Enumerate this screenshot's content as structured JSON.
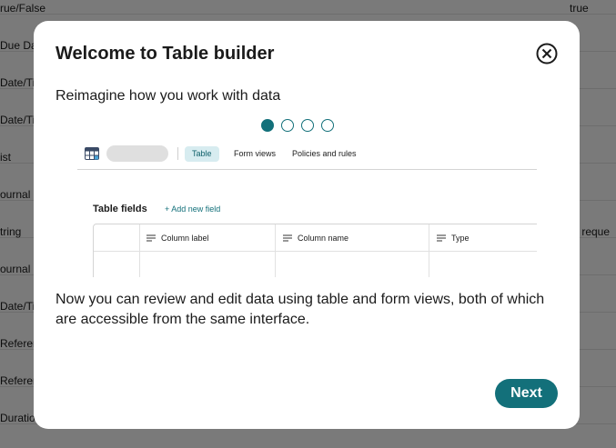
{
  "background": {
    "rows": [
      {
        "col1": "rue/False",
        "col2": "true"
      },
      {
        "col1": "Due Da",
        "col2": ""
      },
      {
        "col1": "Date/Ti",
        "col2": ""
      },
      {
        "col1": "Date/Ti",
        "col2": ""
      },
      {
        "col1": "ist",
        "col2": ""
      },
      {
        "col1": "ournal",
        "col2": ""
      },
      {
        "col1": "tring",
        "col2": "ot reque"
      },
      {
        "col1": "ournal",
        "col2": ""
      },
      {
        "col1": "Date/Ti",
        "col2": ""
      },
      {
        "col1": "Referen",
        "col2": ""
      },
      {
        "col1": "Referen",
        "col2": ""
      },
      {
        "col1": "Duration",
        "col2": ""
      }
    ]
  },
  "modal": {
    "title": "Welcome to Table builder",
    "close_icon": "close-circle-x-icon",
    "subtitle": "Reimagine how you work with data",
    "pagination": {
      "total": 4,
      "current": 1
    },
    "illustration": {
      "tabs": [
        "Table",
        "Form views",
        "Policies and rules"
      ],
      "active_tab": "Table",
      "section_title": "Table fields",
      "add_link": "+ Add new field",
      "columns": [
        "Column label",
        "Column name",
        "Type"
      ]
    },
    "body": "Now you can review and edit data using table and form views, both of which are accessible from the same interface.",
    "next_label": "Next"
  },
  "colors": {
    "accent": "#13707a",
    "overlay": "rgba(0,0,0,0.52)",
    "active_tab_bg": "#d7ecf0"
  }
}
